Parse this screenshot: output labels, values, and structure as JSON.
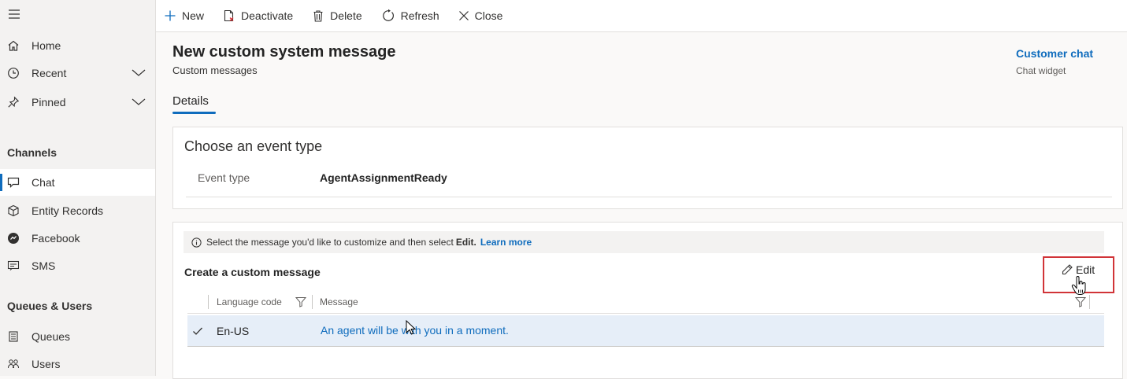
{
  "sidebar": {
    "items": [
      {
        "label": "Home",
        "icon": "home-icon"
      },
      {
        "label": "Recent",
        "icon": "clock-icon"
      },
      {
        "label": "Pinned",
        "icon": "pin-icon"
      }
    ],
    "groups": [
      {
        "title": "Channels",
        "items": [
          {
            "label": "Chat",
            "icon": "chat-icon",
            "active": true
          },
          {
            "label": "Entity Records",
            "icon": "cube-icon"
          },
          {
            "label": "Facebook",
            "icon": "facebook-icon"
          },
          {
            "label": "SMS",
            "icon": "sms-icon"
          }
        ]
      },
      {
        "title": "Queues & Users",
        "items": [
          {
            "label": "Queues",
            "icon": "queue-icon"
          },
          {
            "label": "Users",
            "icon": "users-icon"
          }
        ]
      }
    ]
  },
  "toolbar": {
    "new_label": "New",
    "deactivate_label": "Deactivate",
    "delete_label": "Delete",
    "refresh_label": "Refresh",
    "close_label": "Close"
  },
  "header": {
    "title": "New custom system message",
    "subtitle": "Custom messages",
    "related_link": "Customer chat",
    "related_sub": "Chat widget"
  },
  "tabs": [
    {
      "label": "Details",
      "active": true
    }
  ],
  "event_section": {
    "title": "Choose an event type",
    "field_label": "Event type",
    "field_value": "AgentAssignmentReady"
  },
  "message_section": {
    "info_prefix": "Select the message you'd like to customize and then select",
    "info_bold": "Edit.",
    "info_link": "Learn more",
    "title": "Create a custom message",
    "edit_label": "Edit",
    "columns": [
      "Language code",
      "Message"
    ],
    "rows": [
      {
        "language": "En-US",
        "message": "An agent will be with you in a moment.",
        "selected": true
      }
    ]
  },
  "colors": {
    "accent": "#0f6cbd",
    "highlight_border": "#d13438",
    "selected_row": "#e6eef8"
  }
}
